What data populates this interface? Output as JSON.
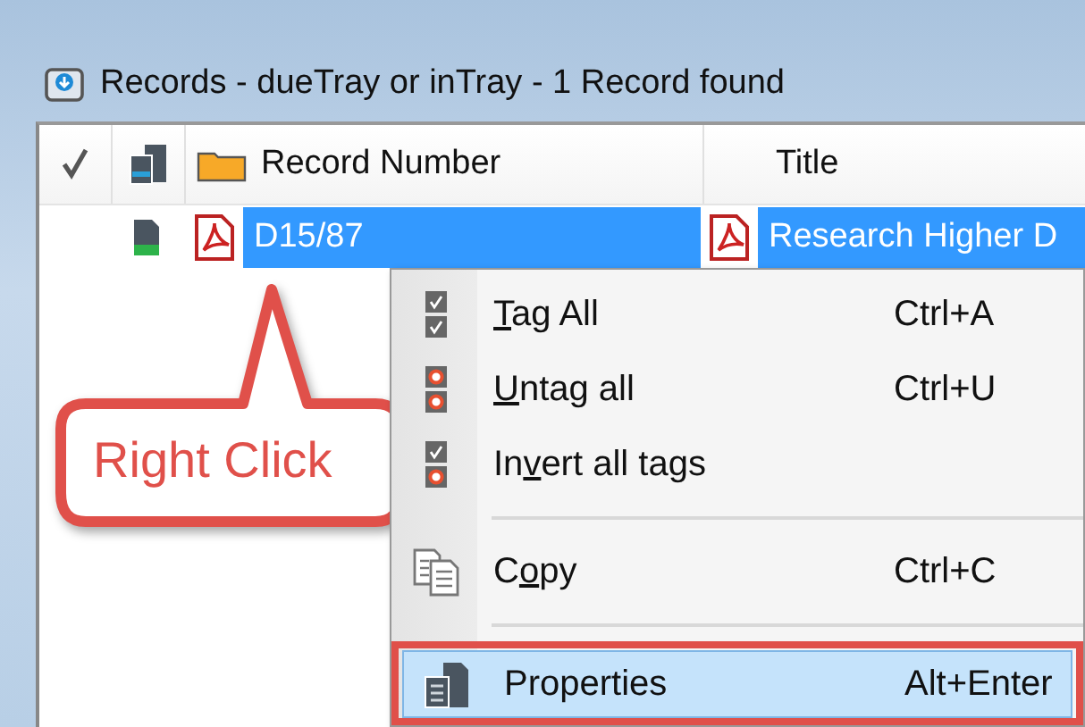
{
  "window": {
    "title": "Records - dueTray or inTray - 1 Record found"
  },
  "table": {
    "columns": [
      {
        "label": "Record Number"
      },
      {
        "label": "Title"
      }
    ],
    "rows": [
      {
        "record_number": "D15/87",
        "title": "Research Higher D",
        "selected": true
      }
    ]
  },
  "context_menu": {
    "items": [
      {
        "kind": "item",
        "key": "T",
        "after": "ag All",
        "shortcut": "Ctrl+A",
        "selected": false,
        "outlined": false
      },
      {
        "kind": "item",
        "key": "U",
        "after": "ntag all",
        "shortcut": "Ctrl+U",
        "selected": false,
        "outlined": false
      },
      {
        "kind": "item",
        "before": "In",
        "key": "v",
        "after": "ert all tags",
        "selected": false,
        "outlined": false
      },
      {
        "kind": "separator"
      },
      {
        "kind": "item",
        "before": "C",
        "key": "o",
        "after": "py",
        "shortcut": "Ctrl+C",
        "selected": false,
        "outlined": false
      },
      {
        "kind": "separator"
      },
      {
        "kind": "item",
        "before": "Properties",
        "shortcut": "Alt+Enter",
        "selected": true,
        "outlined": true
      }
    ]
  },
  "callout": {
    "text": "Right Click"
  }
}
